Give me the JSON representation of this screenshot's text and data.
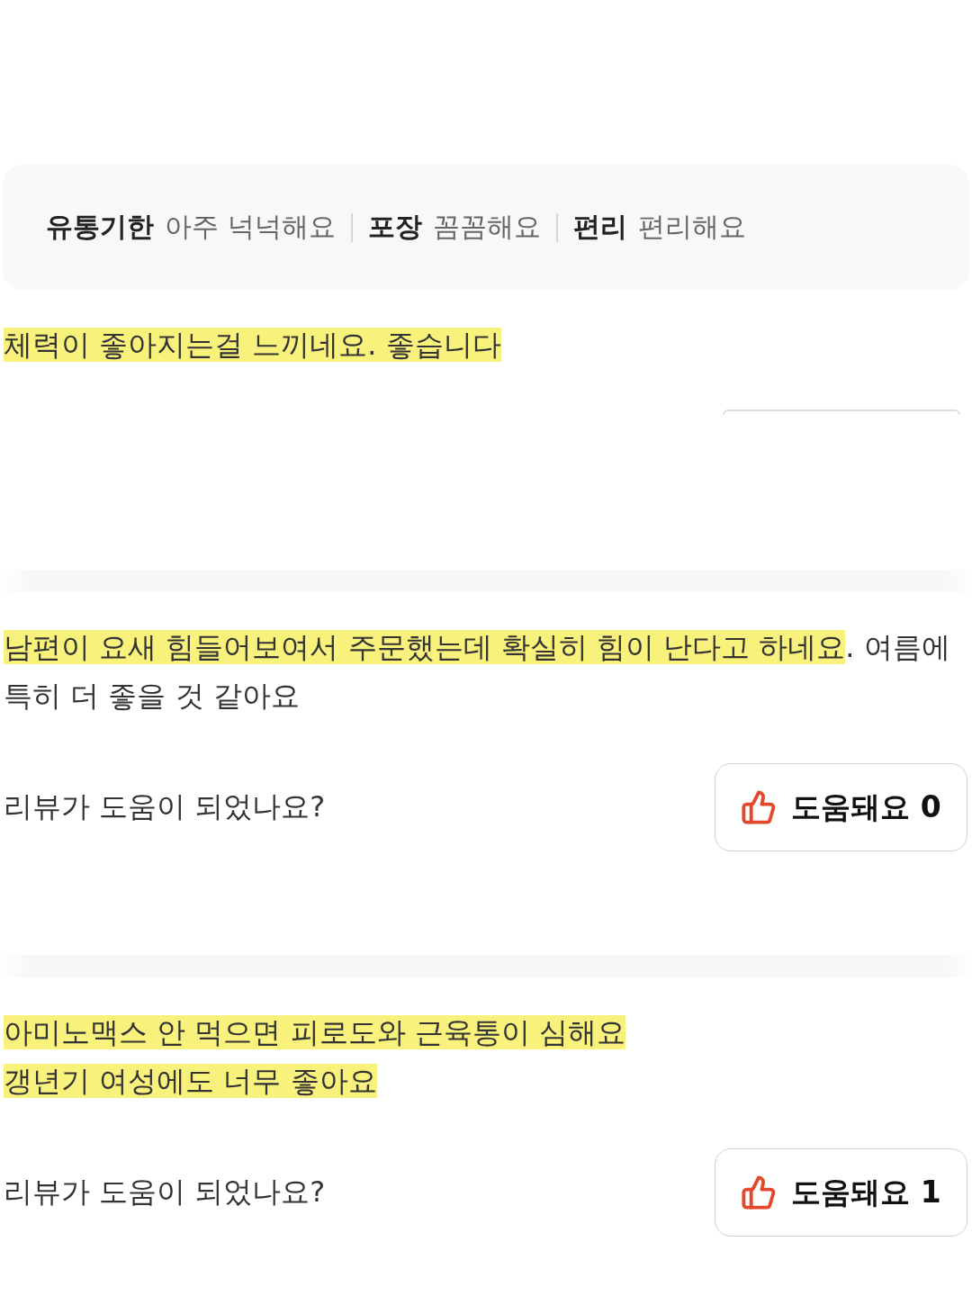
{
  "summary": {
    "items": [
      {
        "label": "유통기한",
        "value": "아주 넉넉해요"
      },
      {
        "label": "포장",
        "value": "꼼꼼해요"
      },
      {
        "label": "편리",
        "value": "편리해요"
      }
    ]
  },
  "reviews": [
    {
      "kind": "cropped",
      "lines": [
        {
          "segments": [
            {
              "text": "체력이 좋아지는걸 느끼네요. 좋습니다",
              "highlighted": true
            }
          ]
        }
      ]
    },
    {
      "kind": "feedback",
      "lines": [
        {
          "segments": [
            {
              "text": "남편이 요새 힘들어보여서 주문했는데 확실히 힘이 난다고 하네요",
              "highlighted": true
            },
            {
              "text": ". 여름에",
              "highlighted": false
            }
          ]
        },
        {
          "segments": [
            {
              "text": "특히 더 좋을 것 같아요",
              "highlighted": false
            }
          ]
        }
      ],
      "helpful": {
        "question": "리뷰가 도움이 되었나요?",
        "button": "도움돼요 0"
      }
    },
    {
      "kind": "feedback",
      "lines": [
        {
          "segments": [
            {
              "text": "아미노맥스 안 먹으면 피로도와 근육통이 심해요 ",
              "highlighted": true
            }
          ]
        },
        {
          "segments": [
            {
              "text": "갱년기 여성에도 너무 좋아요",
              "highlighted": true
            }
          ]
        }
      ],
      "helpful": {
        "question": "리뷰가 도움이 되었나요?",
        "button": "도움돼요 1"
      }
    }
  ]
}
